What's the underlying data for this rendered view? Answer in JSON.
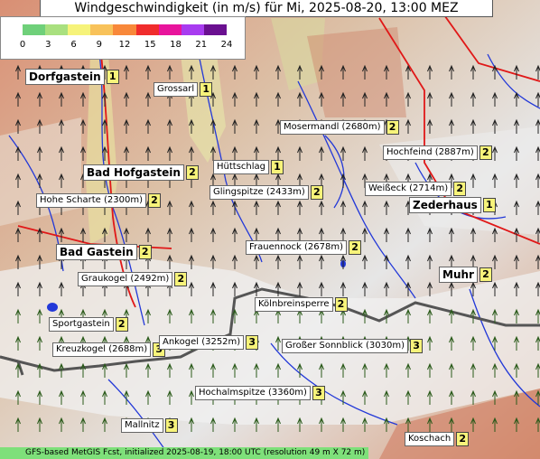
{
  "title": "Windgeschwindigkeit (in m/s) für Mi, 2025-08-20, 13:00 MEZ",
  "legend": {
    "ticks": [
      "0",
      "3",
      "6",
      "9",
      "12",
      "15",
      "18",
      "21",
      "24"
    ],
    "colors": [
      "#6fd07a",
      "#a9e07f",
      "#f6f37a",
      "#f8c25a",
      "#f8883a",
      "#f02c2c",
      "#e8149c",
      "#a83cf0",
      "#6a1090"
    ]
  },
  "places": [
    {
      "name": "Dorfgastein",
      "value": "1",
      "type": "town"
    },
    {
      "name": "Grossarl",
      "value": "1",
      "type": "peak"
    },
    {
      "name": "Mosermandl (2680m)",
      "value": "2",
      "type": "peak"
    },
    {
      "name": "Hochfeind (2887m)",
      "value": "2",
      "type": "peak"
    },
    {
      "name": "Bad Hofgastein",
      "value": "2",
      "type": "town"
    },
    {
      "name": "Hüttschlag",
      "value": "1",
      "type": "peak"
    },
    {
      "name": "Hohe Scharte (2300m)",
      "value": "2",
      "type": "peak"
    },
    {
      "name": "Glingspitze (2433m)",
      "value": "2",
      "type": "peak"
    },
    {
      "name": "Weißeck (2714m)",
      "value": "2",
      "type": "peak"
    },
    {
      "name": "Zederhaus",
      "value": "1",
      "type": "town"
    },
    {
      "name": "Bad Gastein",
      "value": "2",
      "type": "town"
    },
    {
      "name": "Frauennock (2678m)",
      "value": "2",
      "type": "peak"
    },
    {
      "name": "Muhr",
      "value": "2",
      "type": "town"
    },
    {
      "name": "Graukogel (2492m)",
      "value": "2",
      "type": "peak"
    },
    {
      "name": "Kölnbreinsperre",
      "value": "2",
      "type": "peak"
    },
    {
      "name": "Sportgastein",
      "value": "2",
      "type": "peak"
    },
    {
      "name": "Kreuzkogel (2688m)",
      "value": "3",
      "type": "peak"
    },
    {
      "name": "Ankogel (3252m)",
      "value": "3",
      "type": "peak"
    },
    {
      "name": "Großer Sonnblick (3030m)",
      "value": "3",
      "type": "peak"
    },
    {
      "name": "Hochalmspitze (3360m)",
      "value": "3",
      "type": "peak"
    },
    {
      "name": "Mallnitz",
      "value": "3",
      "type": "peak"
    },
    {
      "name": "Koschach",
      "value": "2",
      "type": "peak"
    }
  ],
  "footer": "GFS-based MetGIS Fcst, initialized 2025-08-19, 18:00 UTC  (resolution 49 m X 72 m)"
}
